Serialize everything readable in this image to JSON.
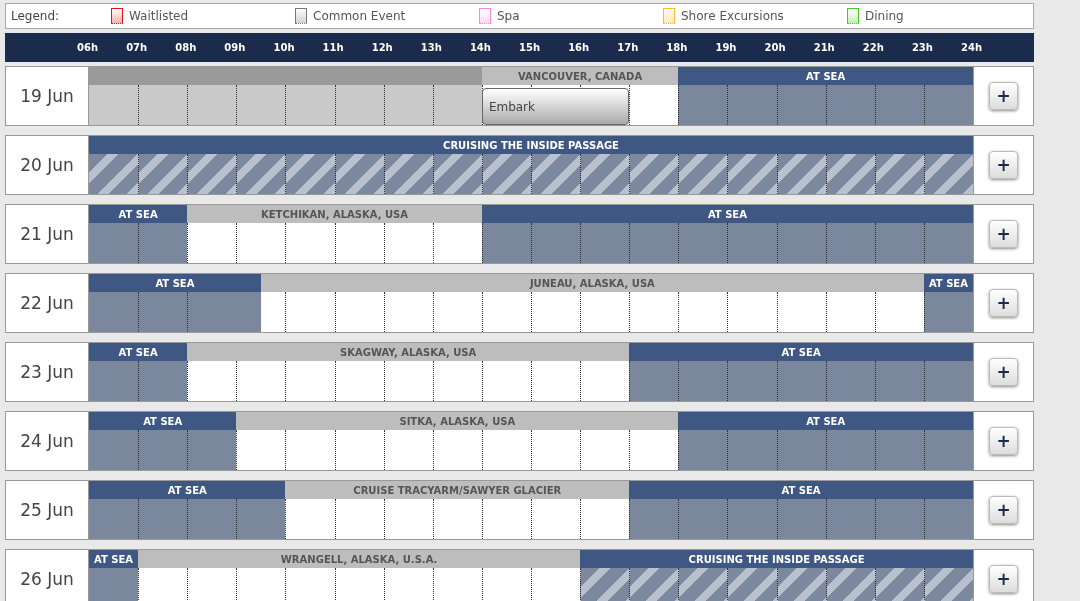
{
  "legend": {
    "label": "Legend:",
    "items": [
      {
        "label": "Waitlisted",
        "color": "#ee1111"
      },
      {
        "label": "Common Event",
        "color": "#777777"
      },
      {
        "label": "Spa",
        "color": "#ff88dd"
      },
      {
        "label": "Shore Excursions",
        "color": "#ffbb22"
      },
      {
        "label": "Dining",
        "color": "#44cc22"
      }
    ]
  },
  "hours": [
    "06h",
    "07h",
    "08h",
    "09h",
    "10h",
    "11h",
    "12h",
    "13h",
    "14h",
    "15h",
    "16h",
    "17h",
    "18h",
    "19h",
    "20h",
    "21h",
    "22h",
    "23h",
    "24h"
  ],
  "days": [
    {
      "date": "19 Jun",
      "add": "+",
      "segments": [
        {
          "kind": "common",
          "cells": [
            {
              "kind": "hour"
            },
            {
              "kind": "hour"
            },
            {
              "kind": "hour"
            },
            {
              "kind": "hour"
            },
            {
              "kind": "hour"
            },
            {
              "kind": "hour"
            },
            {
              "kind": "hour"
            },
            {
              "kind": "hour"
            }
          ]
        },
        {
          "kind": "port",
          "label": "VANCOUVER, CANADA",
          "cells": [
            {
              "kind": "hour"
            },
            {
              "kind": "hour"
            },
            {
              "kind": "hour"
            },
            {
              "kind": "hour"
            }
          ],
          "events": [
            {
              "label": "Embark",
              "kind": "common",
              "cells": [
                {
                  "kind": "hour"
                },
                {
                  "kind": "hour"
                },
                {
                  "kind": "hour"
                }
              ]
            }
          ]
        },
        {
          "kind": "sea",
          "label": "AT SEA",
          "cells": [
            {
              "kind": "hour"
            },
            {
              "kind": "hour"
            },
            {
              "kind": "hour"
            },
            {
              "kind": "hour"
            },
            {
              "kind": "hour"
            },
            {
              "kind": "hour"
            }
          ]
        }
      ]
    },
    {
      "date": "20 Jun",
      "add": "+",
      "segments": [
        {
          "kind": "cruising",
          "label": "CRUISING THE INSIDE PASSAGE",
          "cells": [
            {
              "kind": "hour"
            },
            {
              "kind": "hour"
            },
            {
              "kind": "hour"
            },
            {
              "kind": "hour"
            },
            {
              "kind": "hour"
            },
            {
              "kind": "hour"
            },
            {
              "kind": "hour"
            },
            {
              "kind": "hour"
            },
            {
              "kind": "hour"
            },
            {
              "kind": "hour"
            },
            {
              "kind": "hour"
            },
            {
              "kind": "hour"
            },
            {
              "kind": "hour"
            },
            {
              "kind": "hour"
            },
            {
              "kind": "hour"
            },
            {
              "kind": "hour"
            },
            {
              "kind": "hour"
            },
            {
              "kind": "hour"
            }
          ]
        }
      ]
    },
    {
      "date": "21 Jun",
      "add": "+",
      "segments": [
        {
          "kind": "sea",
          "label": "AT SEA",
          "cells": [
            {
              "kind": "hour"
            },
            {
              "kind": "hour"
            }
          ]
        },
        {
          "kind": "port",
          "label": "KETCHIKAN, ALASKA, USA",
          "cells": [
            {
              "kind": "hour"
            },
            {
              "kind": "hour"
            },
            {
              "kind": "hour"
            },
            {
              "kind": "hour"
            },
            {
              "kind": "hour"
            },
            {
              "kind": "hour"
            }
          ]
        },
        {
          "kind": "sea",
          "label": "AT SEA",
          "cells": [
            {
              "kind": "hour"
            },
            {
              "kind": "hour"
            },
            {
              "kind": "hour"
            },
            {
              "kind": "hour"
            },
            {
              "kind": "hour"
            },
            {
              "kind": "hour"
            },
            {
              "kind": "hour"
            },
            {
              "kind": "hour"
            },
            {
              "kind": "hour"
            },
            {
              "kind": "hour"
            }
          ]
        }
      ]
    },
    {
      "date": "22 Jun",
      "add": "+",
      "segments": [
        {
          "kind": "sea",
          "label": "AT SEA",
          "cells": [
            {
              "kind": "hour"
            },
            {
              "kind": "hour"
            },
            {
              "kind": "hour"
            },
            {
              "kind": "half"
            }
          ]
        },
        {
          "kind": "port",
          "label": "JUNEAU, ALASKA, USA",
          "cells": [
            {
              "kind": "half"
            },
            {
              "kind": "hour"
            },
            {
              "kind": "hour"
            },
            {
              "kind": "hour"
            },
            {
              "kind": "hour"
            },
            {
              "kind": "hour"
            },
            {
              "kind": "hour"
            },
            {
              "kind": "hour"
            },
            {
              "kind": "hour"
            },
            {
              "kind": "hour"
            },
            {
              "kind": "hour"
            },
            {
              "kind": "hour"
            },
            {
              "kind": "hour"
            },
            {
              "kind": "hour"
            }
          ]
        },
        {
          "kind": "sea",
          "label": "AT SEA",
          "cells": [
            {
              "kind": "hour"
            }
          ]
        }
      ]
    },
    {
      "date": "23 Jun",
      "add": "+",
      "segments": [
        {
          "kind": "sea",
          "label": "AT SEA",
          "cells": [
            {
              "kind": "hour"
            },
            {
              "kind": "hour"
            }
          ]
        },
        {
          "kind": "port",
          "label": "SKAGWAY, ALASKA, USA",
          "cells": [
            {
              "kind": "hour"
            },
            {
              "kind": "hour"
            },
            {
              "kind": "hour"
            },
            {
              "kind": "hour"
            },
            {
              "kind": "hour"
            },
            {
              "kind": "hour"
            },
            {
              "kind": "hour"
            },
            {
              "kind": "hour"
            },
            {
              "kind": "hour"
            }
          ]
        },
        {
          "kind": "sea",
          "label": "AT SEA",
          "cells": [
            {
              "kind": "hour"
            },
            {
              "kind": "hour"
            },
            {
              "kind": "hour"
            },
            {
              "kind": "hour"
            },
            {
              "kind": "hour"
            },
            {
              "kind": "hour"
            },
            {
              "kind": "hour"
            }
          ]
        }
      ]
    },
    {
      "date": "24 Jun",
      "add": "+",
      "segments": [
        {
          "kind": "sea",
          "label": "AT SEA",
          "cells": [
            {
              "kind": "hour"
            },
            {
              "kind": "hour"
            },
            {
              "kind": "hour"
            }
          ]
        },
        {
          "kind": "port",
          "label": "SITKA, ALASKA, USA",
          "cells": [
            {
              "kind": "hour"
            },
            {
              "kind": "hour"
            },
            {
              "kind": "hour"
            },
            {
              "kind": "hour"
            },
            {
              "kind": "hour"
            },
            {
              "kind": "hour"
            },
            {
              "kind": "hour"
            },
            {
              "kind": "hour"
            },
            {
              "kind": "hour"
            }
          ]
        },
        {
          "kind": "sea",
          "label": "AT SEA",
          "cells": [
            {
              "kind": "hour"
            },
            {
              "kind": "hour"
            },
            {
              "kind": "hour"
            },
            {
              "kind": "hour"
            },
            {
              "kind": "hour"
            },
            {
              "kind": "hour"
            }
          ]
        }
      ]
    },
    {
      "date": "25 Jun",
      "add": "+",
      "segments": [
        {
          "kind": "sea",
          "label": "AT SEA",
          "cells": [
            {
              "kind": "hour"
            },
            {
              "kind": "hour"
            },
            {
              "kind": "hour"
            },
            {
              "kind": "hour"
            }
          ]
        },
        {
          "kind": "port",
          "label": "CRUISE TRACYARM/SAWYER GLACIER",
          "cells": [
            {
              "kind": "hour"
            },
            {
              "kind": "hour"
            },
            {
              "kind": "hour"
            },
            {
              "kind": "hour"
            },
            {
              "kind": "hour"
            },
            {
              "kind": "hour"
            },
            {
              "kind": "hour"
            }
          ]
        },
        {
          "kind": "sea",
          "label": "AT SEA",
          "cells": [
            {
              "kind": "hour"
            },
            {
              "kind": "hour"
            },
            {
              "kind": "hour"
            },
            {
              "kind": "hour"
            },
            {
              "kind": "hour"
            },
            {
              "kind": "hour"
            },
            {
              "kind": "hour"
            }
          ]
        }
      ]
    },
    {
      "date": "26 Jun",
      "add": "+",
      "segments": [
        {
          "kind": "sea",
          "label": "AT SEA",
          "cells": [
            {
              "kind": "hour"
            }
          ]
        },
        {
          "kind": "port",
          "label": "WRANGELL, ALASKA, U.S.A.",
          "cells": [
            {
              "kind": "hour"
            },
            {
              "kind": "hour"
            },
            {
              "kind": "hour"
            },
            {
              "kind": "hour"
            },
            {
              "kind": "hour"
            },
            {
              "kind": "hour"
            },
            {
              "kind": "hour"
            },
            {
              "kind": "hour"
            },
            {
              "kind": "hour"
            }
          ]
        },
        {
          "kind": "cruising",
          "label": "CRUISING THE INSIDE PASSAGE",
          "cells": [
            {
              "kind": "hour"
            },
            {
              "kind": "hour"
            },
            {
              "kind": "hour"
            },
            {
              "kind": "hour"
            },
            {
              "kind": "hour"
            },
            {
              "kind": "hour"
            },
            {
              "kind": "hour"
            },
            {
              "kind": "hour"
            }
          ]
        }
      ]
    }
  ]
}
